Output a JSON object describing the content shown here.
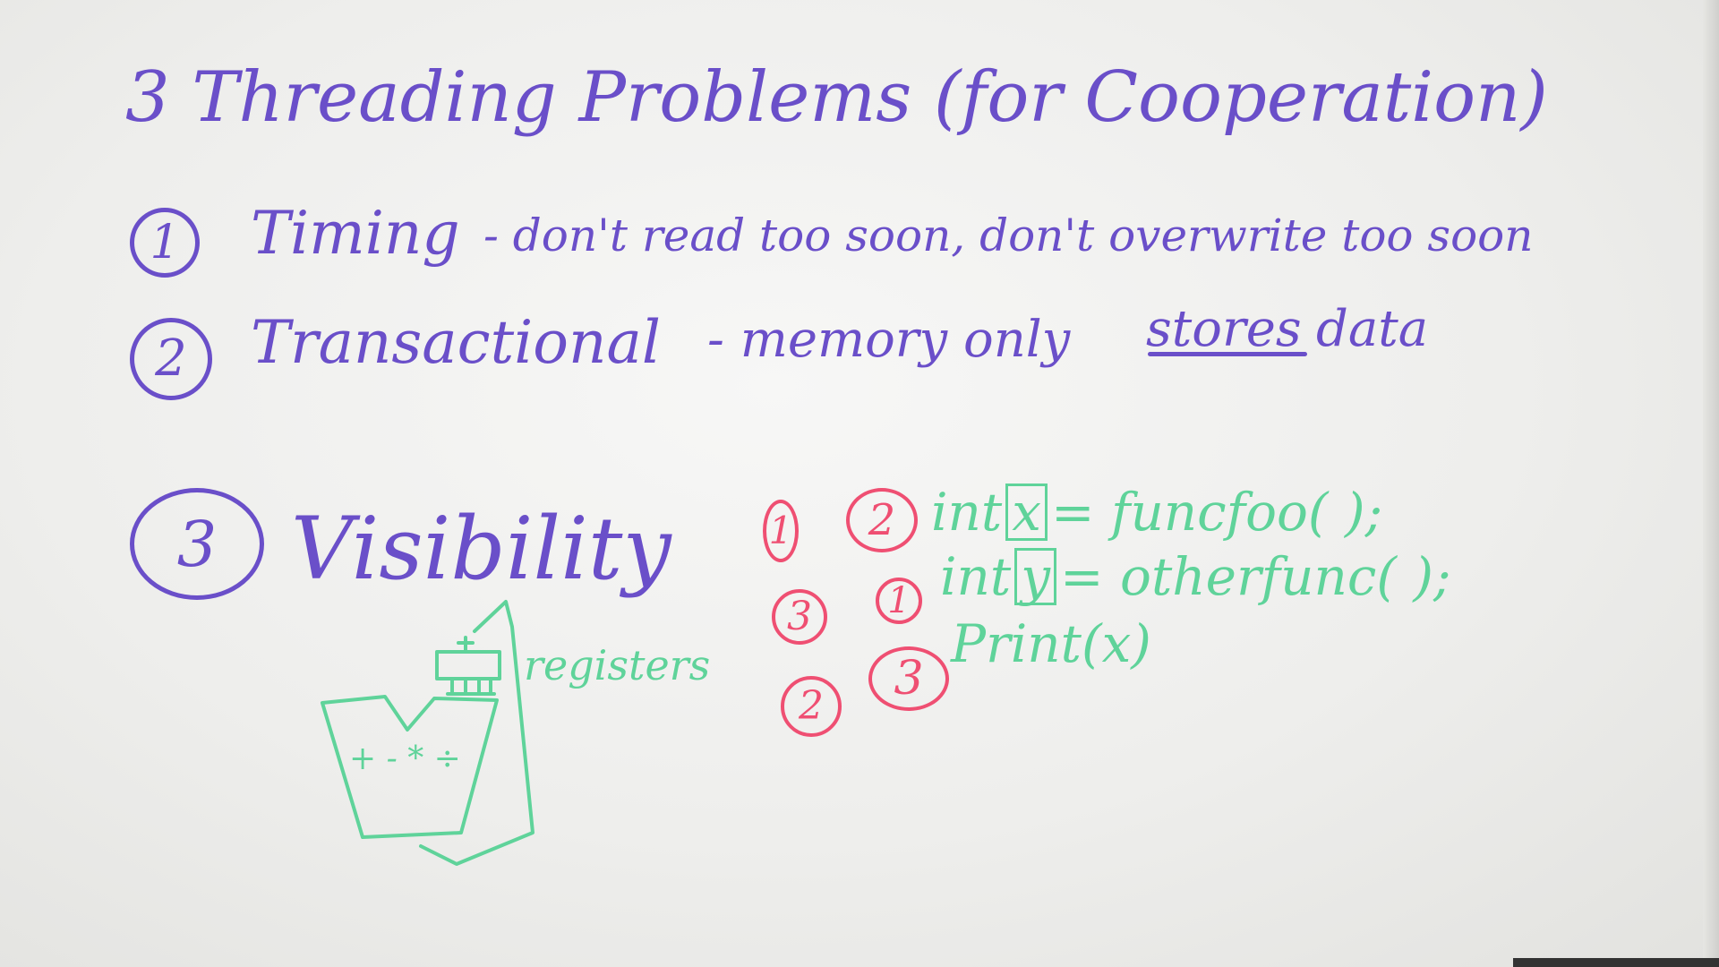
{
  "title": "3 Threading Problems (for Cooperation)",
  "problems": [
    {
      "number": "1",
      "name": "Timing",
      "desc": "- don't read too soon, don't overwrite too soon"
    },
    {
      "number": "2",
      "name": "Transactional",
      "desc_before": "- memory only",
      "desc_underlined": "stores",
      "desc_after": "data"
    },
    {
      "number": "3",
      "name": "Visibility"
    }
  ],
  "diagram": {
    "registers_label": "registers",
    "alu_ops": "+ - * ÷"
  },
  "order_marks": {
    "col1": [
      "1",
      "3",
      "2"
    ],
    "col2": [
      "2",
      "1",
      "3"
    ]
  },
  "code": {
    "line1_prefix": "int",
    "line1_var": "x",
    "line1_rest": "= funcfoo( );",
    "line2_prefix": "int",
    "line2_var": "y",
    "line2_rest": "= otherfunc( );",
    "line3": "Print(x)"
  },
  "colors": {
    "purple_marker": "#6a4fc9",
    "green_marker": "#5fd39a",
    "red_marker": "#ef4f72"
  }
}
